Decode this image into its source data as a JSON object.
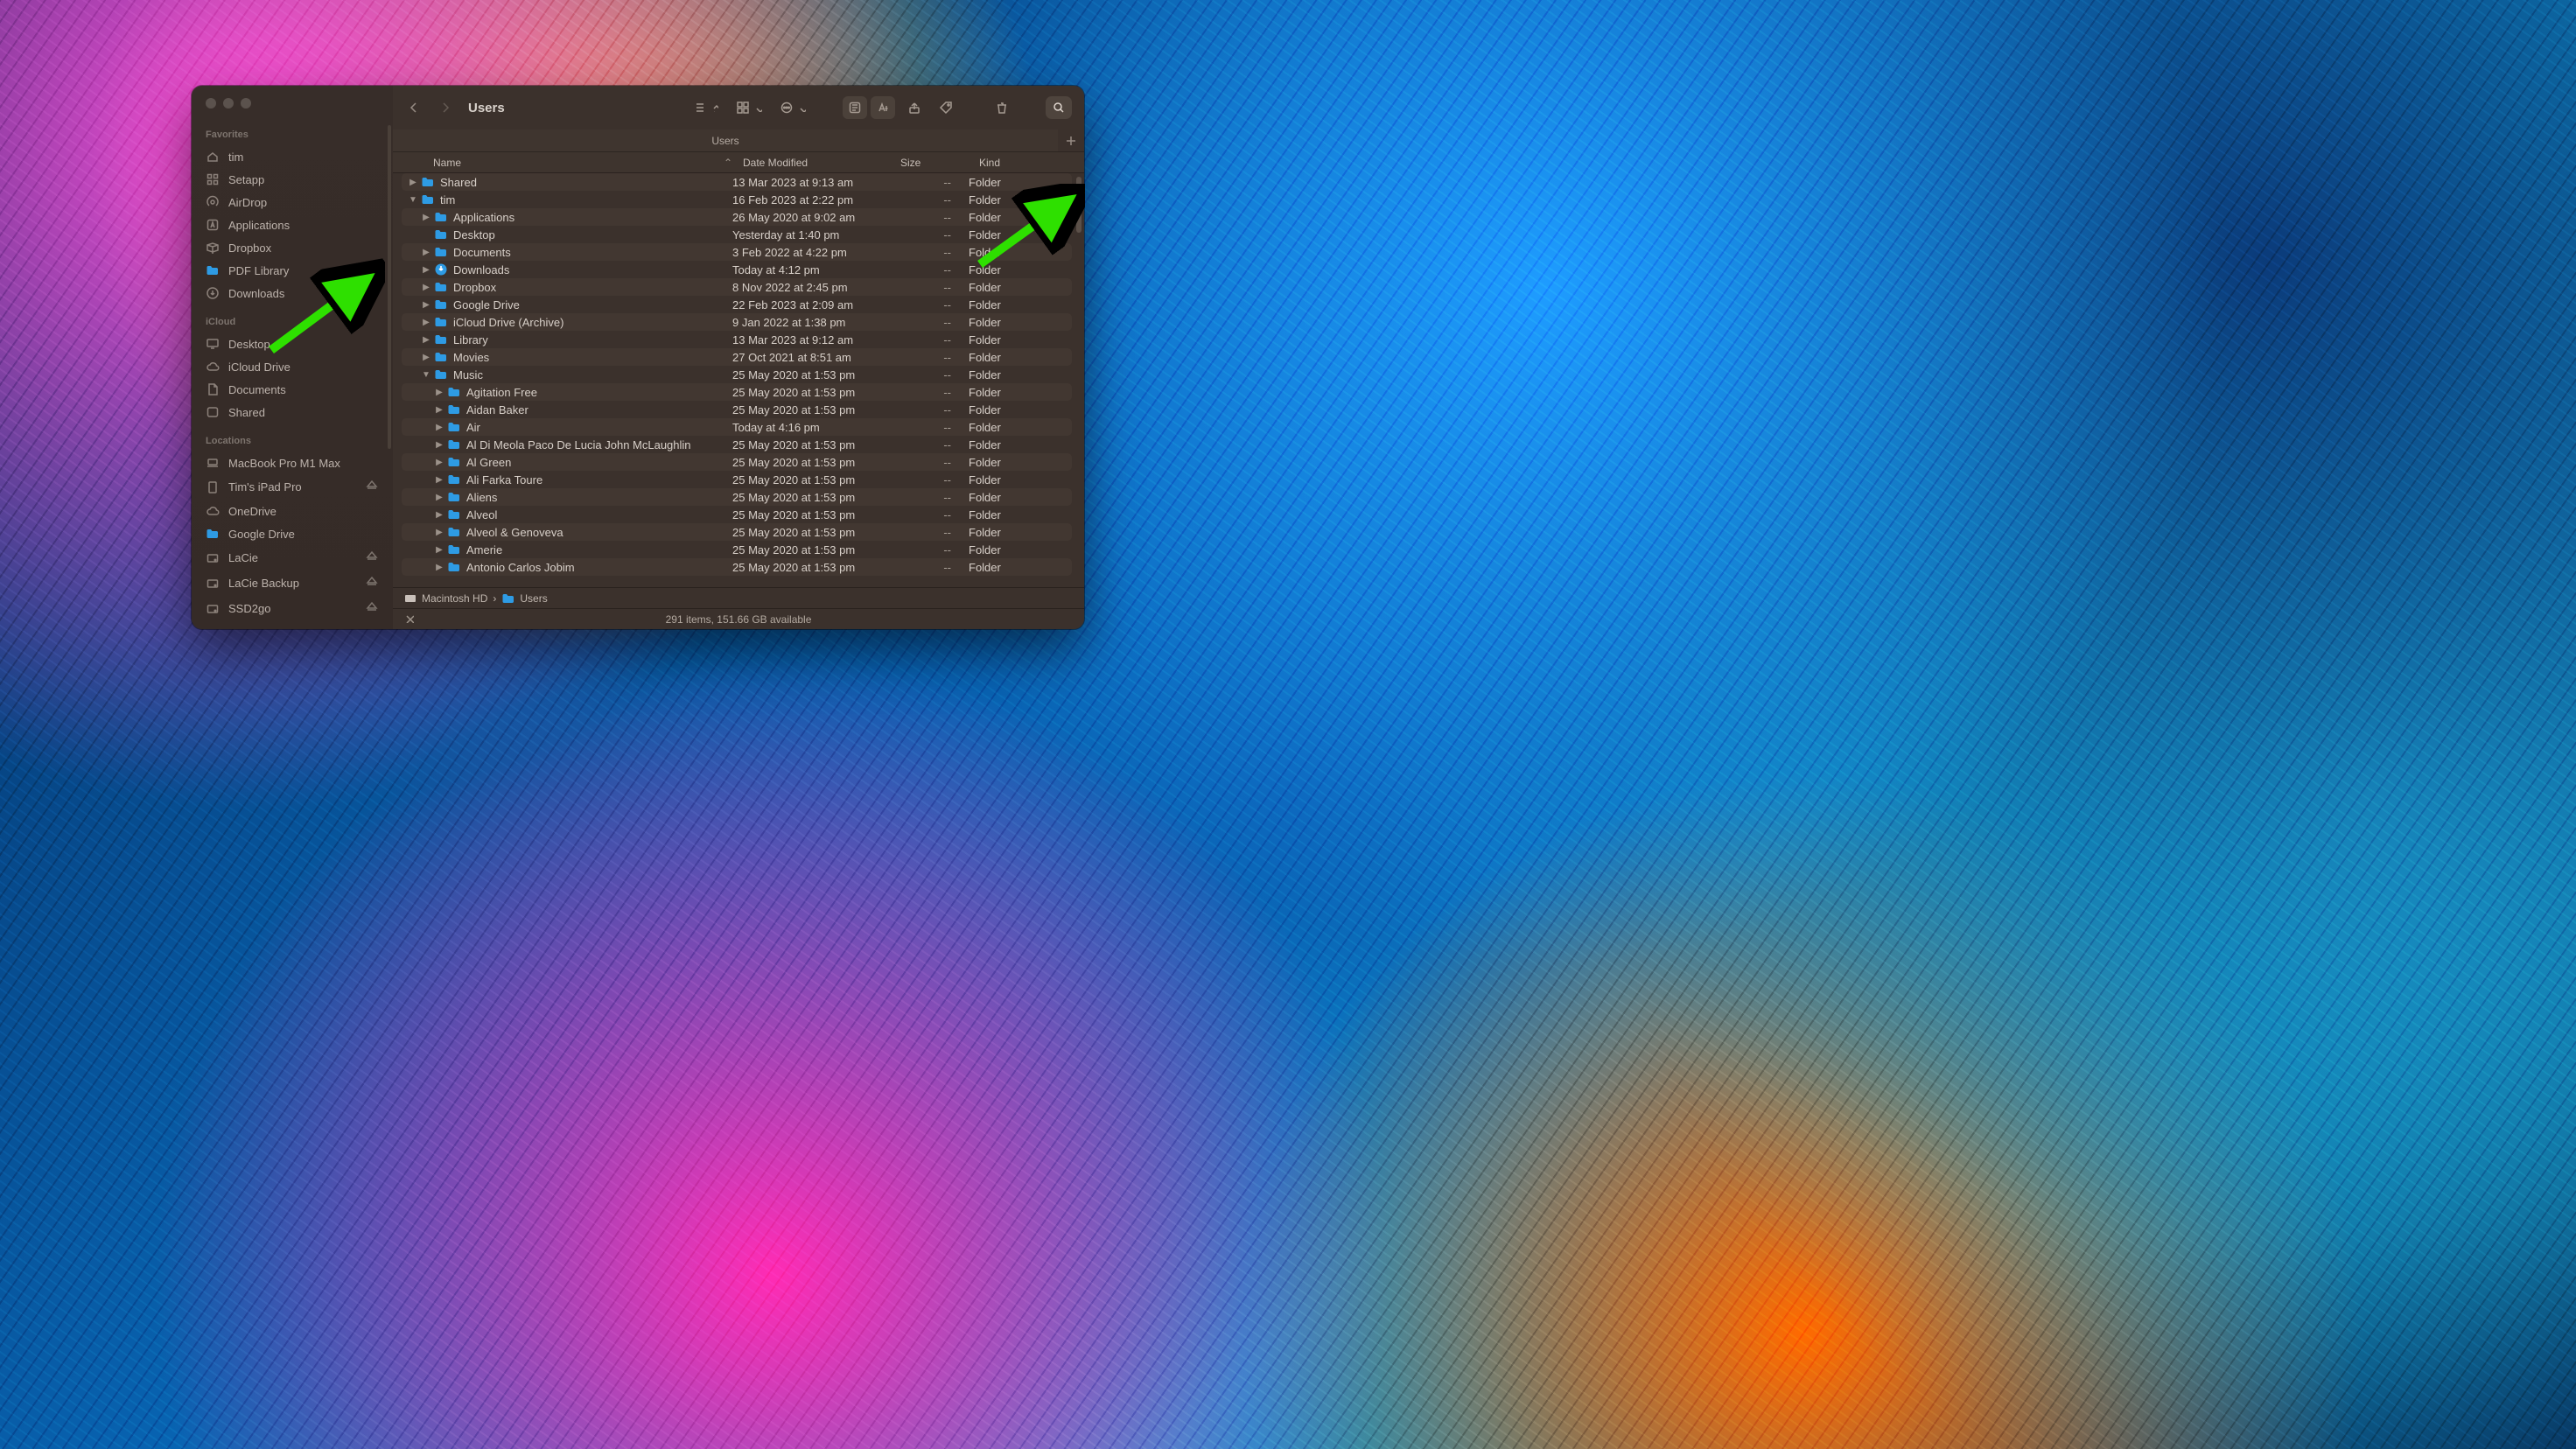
{
  "window_title": "Users",
  "tabs": {
    "current": "Users"
  },
  "sidebar": {
    "sections": [
      {
        "title": "Favorites",
        "items": [
          {
            "icon": "home",
            "label": "tim"
          },
          {
            "icon": "grid",
            "label": "Setapp"
          },
          {
            "icon": "airdrop",
            "label": "AirDrop"
          },
          {
            "icon": "apps",
            "label": "Applications"
          },
          {
            "icon": "box",
            "label": "Dropbox"
          },
          {
            "icon": "folder",
            "label": "PDF Library"
          },
          {
            "icon": "down",
            "label": "Downloads"
          }
        ]
      },
      {
        "title": "iCloud",
        "items": [
          {
            "icon": "desktop",
            "label": "Desktop"
          },
          {
            "icon": "cloud",
            "label": "iCloud Drive"
          },
          {
            "icon": "doc",
            "label": "Documents"
          },
          {
            "icon": "shared",
            "label": "Shared"
          }
        ]
      },
      {
        "title": "Locations",
        "items": [
          {
            "icon": "laptop",
            "label": "MacBook Pro M1 Max"
          },
          {
            "icon": "ipad",
            "label": "Tim's iPad Pro",
            "eject": true
          },
          {
            "icon": "cloud",
            "label": "OneDrive"
          },
          {
            "icon": "folder",
            "label": "Google Drive"
          },
          {
            "icon": "disk",
            "label": "LaCie",
            "eject": true
          },
          {
            "icon": "disk",
            "label": "LaCie Backup",
            "eject": true
          },
          {
            "icon": "disk",
            "label": "SSD2go",
            "eject": true
          }
        ]
      }
    ]
  },
  "columns": {
    "name": "Name",
    "date": "Date Modified",
    "size": "Size",
    "kind": "Kind"
  },
  "rows": [
    {
      "depth": 0,
      "disc": "right",
      "icon": "folder",
      "name": "Shared",
      "date": "13 Mar 2023 at 9:13 am",
      "size": "--",
      "kind": "Folder"
    },
    {
      "depth": 0,
      "disc": "down",
      "icon": "folder",
      "name": "tim",
      "date": "16 Feb 2023 at 2:22 pm",
      "size": "--",
      "kind": "Folder"
    },
    {
      "depth": 1,
      "disc": "right",
      "icon": "folder",
      "name": "Applications",
      "date": "26 May 2020 at 9:02 am",
      "size": "--",
      "kind": "Folder"
    },
    {
      "depth": 1,
      "disc": "none",
      "icon": "folder",
      "name": "Desktop",
      "date": "Yesterday at 1:40 pm",
      "size": "--",
      "kind": "Folder"
    },
    {
      "depth": 1,
      "disc": "right",
      "icon": "folder",
      "name": "Documents",
      "date": "3 Feb 2022 at 4:22 pm",
      "size": "--",
      "kind": "Folder"
    },
    {
      "depth": 1,
      "disc": "right",
      "icon": "dl",
      "name": "Downloads",
      "date": "Today at 4:12 pm",
      "size": "--",
      "kind": "Folder"
    },
    {
      "depth": 1,
      "disc": "right",
      "icon": "folder",
      "name": "Dropbox",
      "date": "8 Nov 2022 at 2:45 pm",
      "size": "--",
      "kind": "Folder"
    },
    {
      "depth": 1,
      "disc": "right",
      "icon": "folder",
      "name": "Google Drive",
      "date": "22 Feb 2023 at 2:09 am",
      "size": "--",
      "kind": "Folder"
    },
    {
      "depth": 1,
      "disc": "right",
      "icon": "folder",
      "name": "iCloud Drive (Archive)",
      "date": "9 Jan 2022 at 1:38 pm",
      "size": "--",
      "kind": "Folder"
    },
    {
      "depth": 1,
      "disc": "right",
      "icon": "folder",
      "name": "Library",
      "date": "13 Mar 2023 at 9:12 am",
      "size": "--",
      "kind": "Folder"
    },
    {
      "depth": 1,
      "disc": "right",
      "icon": "folder",
      "name": "Movies",
      "date": "27 Oct 2021 at 8:51 am",
      "size": "--",
      "kind": "Folder"
    },
    {
      "depth": 1,
      "disc": "down",
      "icon": "folder",
      "name": "Music",
      "date": "25 May 2020 at 1:53 pm",
      "size": "--",
      "kind": "Folder"
    },
    {
      "depth": 2,
      "disc": "right",
      "icon": "folder",
      "name": "Agitation Free",
      "date": "25 May 2020 at 1:53 pm",
      "size": "--",
      "kind": "Folder"
    },
    {
      "depth": 2,
      "disc": "right",
      "icon": "folder",
      "name": "Aidan Baker",
      "date": "25 May 2020 at 1:53 pm",
      "size": "--",
      "kind": "Folder"
    },
    {
      "depth": 2,
      "disc": "right",
      "icon": "folder",
      "name": "Air",
      "date": "Today at 4:16 pm",
      "size": "--",
      "kind": "Folder"
    },
    {
      "depth": 2,
      "disc": "right",
      "icon": "folder",
      "name": "Al Di Meola Paco De Lucia John McLaughlin",
      "date": "25 May 2020 at 1:53 pm",
      "size": "--",
      "kind": "Folder"
    },
    {
      "depth": 2,
      "disc": "right",
      "icon": "folder",
      "name": "Al Green",
      "date": "25 May 2020 at 1:53 pm",
      "size": "--",
      "kind": "Folder"
    },
    {
      "depth": 2,
      "disc": "right",
      "icon": "folder",
      "name": "Ali Farka Toure",
      "date": "25 May 2020 at 1:53 pm",
      "size": "--",
      "kind": "Folder"
    },
    {
      "depth": 2,
      "disc": "right",
      "icon": "folder",
      "name": "Aliens",
      "date": "25 May 2020 at 1:53 pm",
      "size": "--",
      "kind": "Folder"
    },
    {
      "depth": 2,
      "disc": "right",
      "icon": "folder",
      "name": "Alveol",
      "date": "25 May 2020 at 1:53 pm",
      "size": "--",
      "kind": "Folder"
    },
    {
      "depth": 2,
      "disc": "right",
      "icon": "folder",
      "name": "Alveol & Genoveva",
      "date": "25 May 2020 at 1:53 pm",
      "size": "--",
      "kind": "Folder"
    },
    {
      "depth": 2,
      "disc": "right",
      "icon": "folder",
      "name": "Amerie",
      "date": "25 May 2020 at 1:53 pm",
      "size": "--",
      "kind": "Folder"
    },
    {
      "depth": 2,
      "disc": "right",
      "icon": "folder",
      "name": "Antonio Carlos Jobim",
      "date": "25 May 2020 at 1:53 pm",
      "size": "--",
      "kind": "Folder"
    }
  ],
  "pathbar": [
    {
      "icon": "hd",
      "label": "Macintosh HD"
    },
    {
      "icon": "folder",
      "label": "Users"
    }
  ],
  "status": "291 items, 151.66 GB available"
}
